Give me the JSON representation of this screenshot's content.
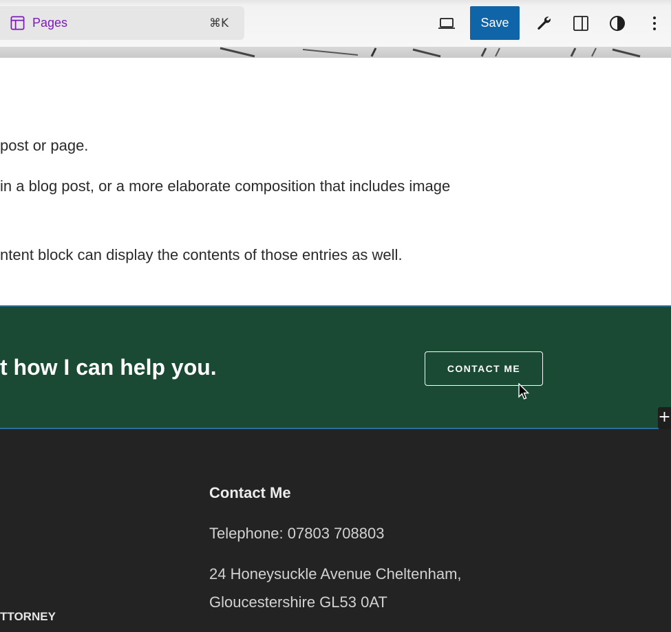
{
  "toolbar": {
    "pages_label": "Pages",
    "shortcut": "⌘K",
    "save_label": "Save",
    "icons": [
      "pages-icon",
      "desktop-view-icon",
      "wrench-icon",
      "sidebar-toggle-icon",
      "contrast-icon",
      "more-options-icon"
    ],
    "accent_color": "#1064a8",
    "pages_color": "#7a1bb4"
  },
  "content": {
    "paragraphs": [
      "post or page.",
      "in a blog post, or a more elaborate composition that includes image",
      "ntent block can display the contents of those entries as well."
    ]
  },
  "cta": {
    "heading": "t how I can help you.",
    "button_label": "CONTACT ME",
    "background": "#1a4a34"
  },
  "inserter": {
    "label": "+"
  },
  "footer": {
    "heading": "Contact Me",
    "telephone": "Telephone: 07803 708803",
    "address_line1": "24 Honeysuckle Avenue Cheltenham,",
    "address_line2": "Gloucestershire GL53 0AT",
    "brand": "TTORNEY",
    "background": "#232323"
  }
}
